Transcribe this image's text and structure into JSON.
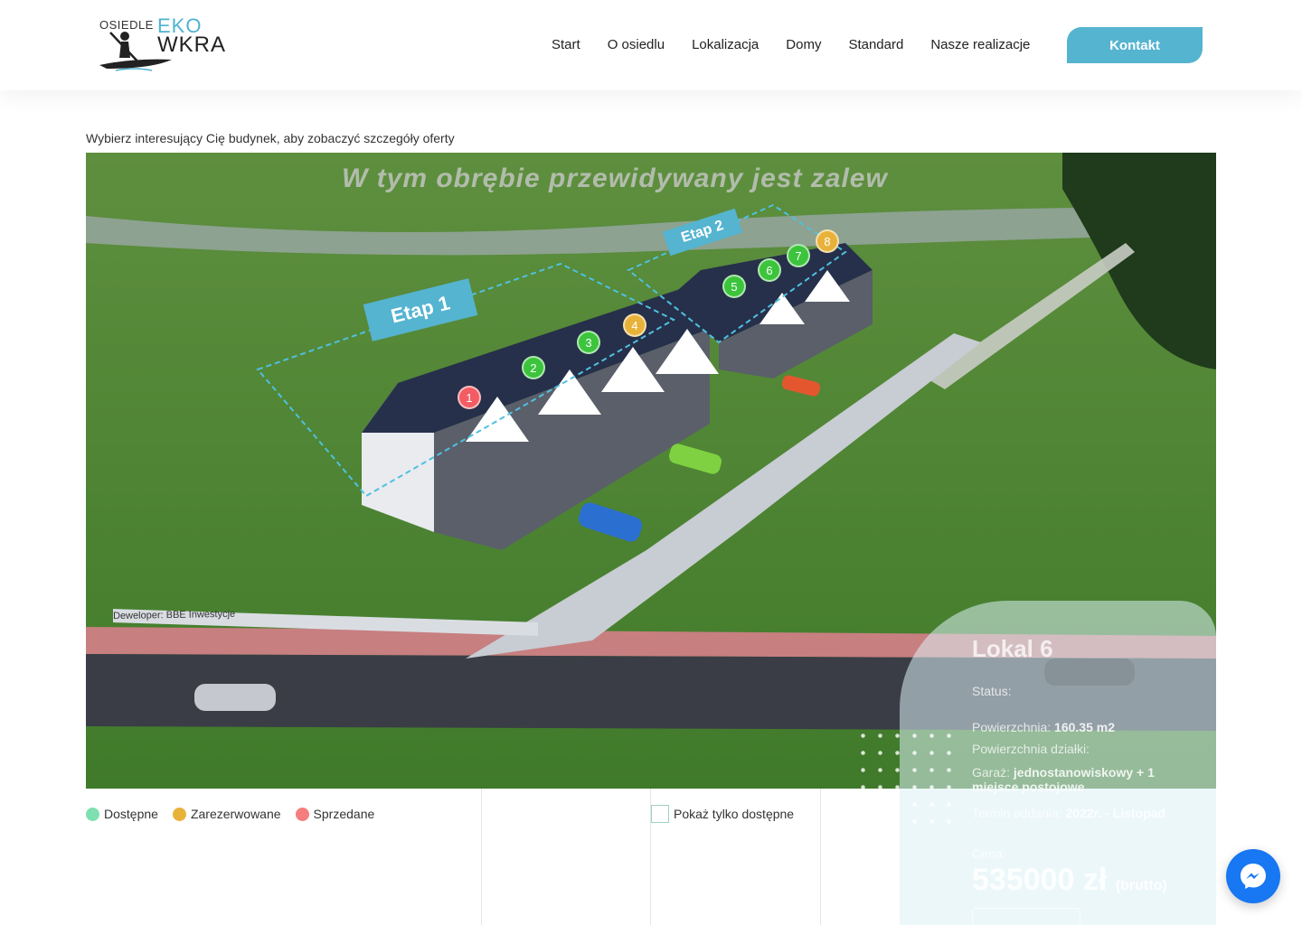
{
  "logo": {
    "top": "OSIEDLE",
    "eko": "EKO",
    "wkra": "WKRA"
  },
  "nav": {
    "items": [
      "Start",
      "O osiedlu",
      "Lokalizacja",
      "Domy",
      "Standard",
      "Nasze realizacje"
    ],
    "contact_label": "Kontakt"
  },
  "intro_text": "Wybierz interesujący Cię budynek, aby zobaczyć szczegóły oferty",
  "scene": {
    "banner": "W tym obrębie przewidywany jest zalew",
    "etap1": "Etap 1",
    "etap2": "Etap 2",
    "developer_sign": "Deweloper: BBE Inwestycje",
    "markers": [
      {
        "num": "1",
        "status": "sold"
      },
      {
        "num": "2",
        "status": "available"
      },
      {
        "num": "3",
        "status": "available"
      },
      {
        "num": "4",
        "status": "reserved"
      },
      {
        "num": "5",
        "status": "available"
      },
      {
        "num": "6",
        "status": "available"
      },
      {
        "num": "7",
        "status": "available"
      },
      {
        "num": "8",
        "status": "reserved"
      }
    ]
  },
  "info_panel": {
    "title": "Lokal 6",
    "status_label": "Status:",
    "area_label": "Powierzchnia:",
    "area_value": "160.35 m2",
    "plot_label": "Powierzchnia działki:",
    "type_label": "Garaż:",
    "type_value": "jednostanowiskowy + 1 miejsce postojowe",
    "date_label": "Termin oddania:",
    "date_value": "2022r. - Listopad",
    "price_label": "Cena:",
    "price_value": "535000 zł",
    "price_suffix": "(brutto)"
  },
  "legend": {
    "available": "Dostępne",
    "reserved": "Zarezerwowane",
    "sold": "Sprzedane",
    "colors": {
      "available": "#7ee0b0",
      "reserved": "#e8b23a",
      "sold": "#f57d7d"
    }
  },
  "filter": {
    "label": "Pokaż tylko dostępne",
    "checked": false
  },
  "colors": {
    "accent": "#55b4d0",
    "marker_available": "#3cc43c",
    "marker_reserved": "#e8b23a",
    "marker_sold": "#f25c62"
  }
}
